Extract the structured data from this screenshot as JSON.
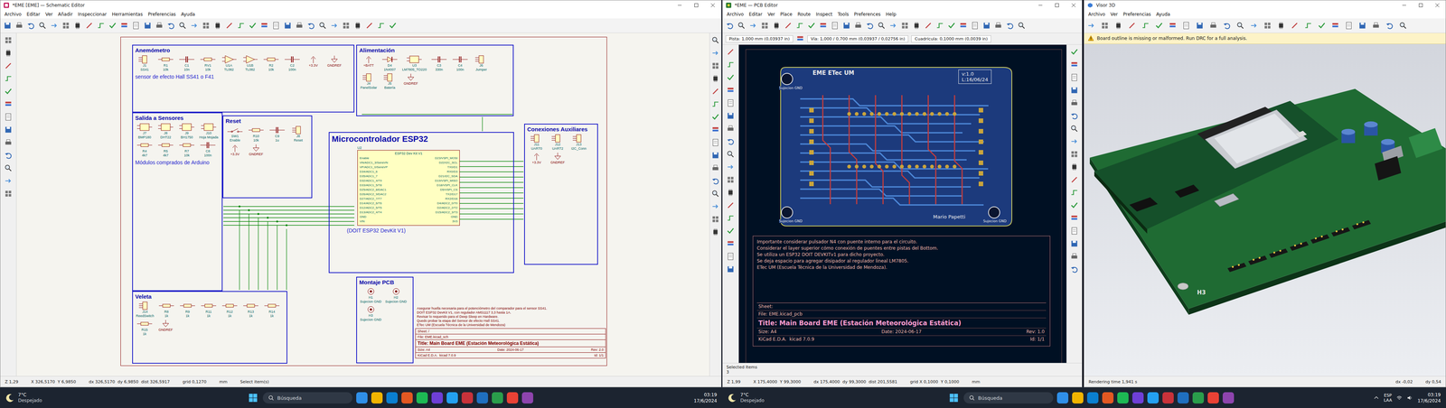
{
  "schematic": {
    "window": {
      "title": "*EME [EME] — Schematic Editor"
    },
    "menu": [
      "Archivo",
      "Editar",
      "Ver",
      "Añadir",
      "Inspeccionar",
      "Herramientas",
      "Preferencias",
      "Ayuda"
    ],
    "blocks": [
      {
        "title": "Anemómetro",
        "caption": "sensor de efecto Hall SS41 o F41",
        "parts": [
          {
            "kind": "connector",
            "ref": "J1",
            "value": "SS41"
          },
          {
            "kind": "resistor",
            "ref": "R1",
            "value": "10k"
          },
          {
            "kind": "capacitor",
            "ref": "C1",
            "value": "10n"
          },
          {
            "kind": "resistor",
            "ref": "RV1",
            "value": "10k"
          },
          {
            "kind": "opamp",
            "ref": "U1A",
            "value": "TL082"
          },
          {
            "kind": "opamp",
            "ref": "U1B",
            "value": "TL082"
          },
          {
            "kind": "resistor",
            "ref": "R2",
            "value": "10k"
          },
          {
            "kind": "capacitor",
            "ref": "C2",
            "value": "100n"
          },
          {
            "kind": "power",
            "ref": "+3.3V"
          },
          {
            "kind": "ground",
            "ref": "GNDREF"
          }
        ]
      },
      {
        "title": "Alimentación",
        "parts": [
          {
            "kind": "power",
            "ref": "+BATT"
          },
          {
            "kind": "diode",
            "ref": "D4",
            "value": "1N4007"
          },
          {
            "kind": "ic",
            "ref": "U3",
            "value": "LM7805_TO220"
          },
          {
            "kind": "capacitor",
            "ref": "C3",
            "value": "330n"
          },
          {
            "kind": "capacitor",
            "ref": "C4",
            "value": "100n"
          },
          {
            "kind": "connector",
            "ref": "J6",
            "value": "Jumper"
          },
          {
            "kind": "connector",
            "ref": "J4",
            "value": "PanelSolar"
          },
          {
            "kind": "connector",
            "ref": "J5",
            "value": "Batería"
          },
          {
            "kind": "ground",
            "ref": "GNDREF"
          }
        ]
      },
      {
        "title": "Salida a Sensores",
        "caption": "Módulos comprados de Arduino",
        "parts": [
          {
            "kind": "module",
            "ref": "J7",
            "value": "BMP180"
          },
          {
            "kind": "module",
            "ref": "J8",
            "value": "DHT22"
          },
          {
            "kind": "module",
            "ref": "J9",
            "value": "BH1750"
          },
          {
            "kind": "module",
            "ref": "J10",
            "value": "Hoja Mojada"
          },
          {
            "kind": "resistor",
            "ref": "R4",
            "value": "4k7"
          },
          {
            "kind": "resistor",
            "ref": "R5",
            "value": "4k7"
          },
          {
            "kind": "resistor",
            "ref": "R7",
            "value": "10k"
          },
          {
            "kind": "capacitor",
            "ref": "C8",
            "value": "100n"
          }
        ]
      },
      {
        "title": "Reset",
        "parts": [
          {
            "kind": "switch",
            "ref": "SW1",
            "value": "Enable"
          },
          {
            "kind": "resistor",
            "ref": "R10",
            "value": "10k"
          },
          {
            "kind": "capacitor",
            "ref": "C9",
            "value": "1u"
          },
          {
            "kind": "connector",
            "ref": "J8",
            "value": "Reset"
          },
          {
            "kind": "power",
            "ref": "+3.3V"
          },
          {
            "kind": "ground",
            "ref": "GNDREF"
          }
        ]
      },
      {
        "title": "Microcontrolador ESP32",
        "caption": "(DOIT ESP32 DevKit V1)",
        "module": {
          "ref": "U2",
          "name": "ESP32 Dev Kit V1",
          "left_pins": [
            "Enable",
            "VN/ADC1_3/SensVN",
            "VP/ADC1_0/SensVP",
            "D34/ADC1_6",
            "D35/ADC1_7",
            "D32/ADC1_4/T9",
            "D33/ADC1_5/T8",
            "D25/ADC2_8/DAC1",
            "D26/ADC2_9/DAC2",
            "D27/ADC2_7/T7",
            "D14/ADC2_6/T6",
            "D12/ADC2_5/T5",
            "D13/ADC2_4/T4",
            "GND",
            "VIN"
          ],
          "right_pins": [
            "D23/VSPI_MOSI",
            "D22/I2C_SCL",
            "TX0/D1",
            "RX0/D3",
            "D21/I2C_SDA",
            "D19/VSPI_MISO",
            "D18/VSPI_CLK",
            "D5/VSPI_CS",
            "TX2/D17",
            "RX2/D16",
            "D4/ADC2_0/T0",
            "D2/ADC2_2/T2",
            "D15/ADC2_3/T3",
            "GND",
            "3V3"
          ]
        }
      },
      {
        "title": "Conexiones Auxiliares",
        "parts": [
          {
            "kind": "connector",
            "ref": "J11",
            "value": "UART0"
          },
          {
            "kind": "connector",
            "ref": "J12",
            "value": "UART2"
          },
          {
            "kind": "connector",
            "ref": "J13",
            "value": "I2C_Conn"
          },
          {
            "kind": "power",
            "ref": "+3.3V"
          },
          {
            "kind": "ground",
            "ref": "GNDREF"
          }
        ]
      },
      {
        "title": "Veleta",
        "parts": [
          {
            "kind": "connector",
            "ref": "J14",
            "value": "ReedSwitch"
          },
          {
            "kind": "resistor",
            "ref": "R8",
            "value": "1k"
          },
          {
            "kind": "resistor",
            "ref": "R9",
            "value": "1k"
          },
          {
            "kind": "resistor",
            "ref": "R11",
            "value": "1k"
          },
          {
            "kind": "resistor",
            "ref": "R12",
            "value": "1k"
          },
          {
            "kind": "resistor",
            "ref": "R13",
            "value": "1k"
          },
          {
            "kind": "resistor",
            "ref": "R14",
            "value": "1k"
          },
          {
            "kind": "resistor",
            "ref": "R15",
            "value": "1k"
          },
          {
            "kind": "ground",
            "ref": "GNDREF"
          }
        ]
      },
      {
        "title": "Montaje PCB",
        "parts": [
          {
            "kind": "hole",
            "ref": "H1",
            "value": "Sujecion GND"
          },
          {
            "kind": "hole",
            "ref": "H2",
            "value": "Sujecion GND"
          },
          {
            "kind": "hole",
            "ref": "H3",
            "value": "Sujecion GND"
          }
        ]
      }
    ],
    "title_block": {
      "notes": [
        "Asegurar huella necesaria para el potenciómetro del comparador para el sensor SS41.",
        "DOIT ESP32 DevKit V1, con regulador AMS1117 3,3 hasta 1A.",
        "Revisar lo requerido para el Deep Sleep en Hardware.",
        "Quedo probar la etapa del Sensor de efecto Hall SS41.",
        "ETec UM (Escuela Técnica de la Universidad de Mendoza)"
      ],
      "sheet": "Sheet: /",
      "file": "File: EME.kicad_sch",
      "title": "Title: Main Board EME (Estación Meteorológica Estática)",
      "size": "Size: A4",
      "date": "Date: 2024-06-17",
      "rev": "Rev: 2.0",
      "tool": "KiCad E.D.A.  kicad 7.0.9",
      "id": "Id: 1/1"
    },
    "status": [
      "Z 1,29",
      "X 326,5170  Y 6,9850",
      "dx 326,5170  dy 6,9850  dist 326,5917",
      "grid 0,1270",
      "mm",
      "Select item(s)"
    ]
  },
  "pcb": {
    "window": {
      "title": "*EME — PCB Editor"
    },
    "menu": [
      "Archivo",
      "Editar",
      "Ver",
      "Place",
      "Route",
      "Inspect",
      "Tools",
      "Preferences",
      "Help"
    ],
    "track": "Pista: 1,000 mm (0,03937 in)",
    "via": "Vía: 1,000 / 0,700 mm (0,03937 / 0,02756 in)",
    "grid": "Cuadrícula: 0,1000 mm (0,0039 in)",
    "board": {
      "title": "EME ETec UM",
      "version": "v:1.0",
      "date": "L:16/06/24",
      "author": "Mario Papetti",
      "holes": [
        "Sujecion GND",
        "Sujecion GND",
        "Sujecion GND"
      ]
    },
    "notes": [
      "Importante considerar pulsador N4 con puente interno para el circuito.",
      "Considerar el layer superior cómo conexión de puentes entre pistas del Bottom.",
      "Se utiliza un ESP32 DOIT DEVKITv1 para dicho proyecto.",
      "Se deja espacio para agregar disipador al regulador lineal LM7805.",
      "ETec UM (Escuela Técnica de la Universidad de Mendoza)."
    ],
    "title_block": {
      "sheet": "Sheet:",
      "file": "File: EME.kicad_pcb",
      "title": "Title: Main Board EME (Estación Meteorológica Estática)",
      "size": "Size: A4",
      "date": "Date: 2024-06-17",
      "rev": "Rev: 1.0",
      "tool": "KiCad E.D.A.  kicad 7.0.9",
      "id": "Id: 1/1"
    },
    "selected": {
      "label": "Selected Items",
      "count": "3"
    },
    "status": [
      "Z 1,99",
      "X 175,4000  Y 99,3000",
      "dx 175,4000  dy 99,3000  dist 201,5581",
      "grid X 0,1000  Y 0,1000",
      "mm"
    ]
  },
  "viewer": {
    "window": {
      "title": "Visor 3D"
    },
    "menu": [
      "Archivo",
      "Ver",
      "Preferencias",
      "Ayuda"
    ],
    "warning": "Board outline is missing or malformed. Run DRC for a full analysis.",
    "board_labels": [
      "H3"
    ],
    "status": [
      "Rendering time 1,941 s",
      "dx -0,02",
      "dy 0,54"
    ]
  },
  "taskbars": [
    {
      "temp": "7°C",
      "weather": "Despejado",
      "search": "Búsqueda",
      "time": "03:19",
      "date": "17/6/2024"
    },
    {
      "temp": "7°C",
      "weather": "Despejado",
      "search": "Búsqueda",
      "lang": [
        "ESP",
        "LAA"
      ],
      "time": "03:19",
      "date": "17/6/2024"
    }
  ]
}
